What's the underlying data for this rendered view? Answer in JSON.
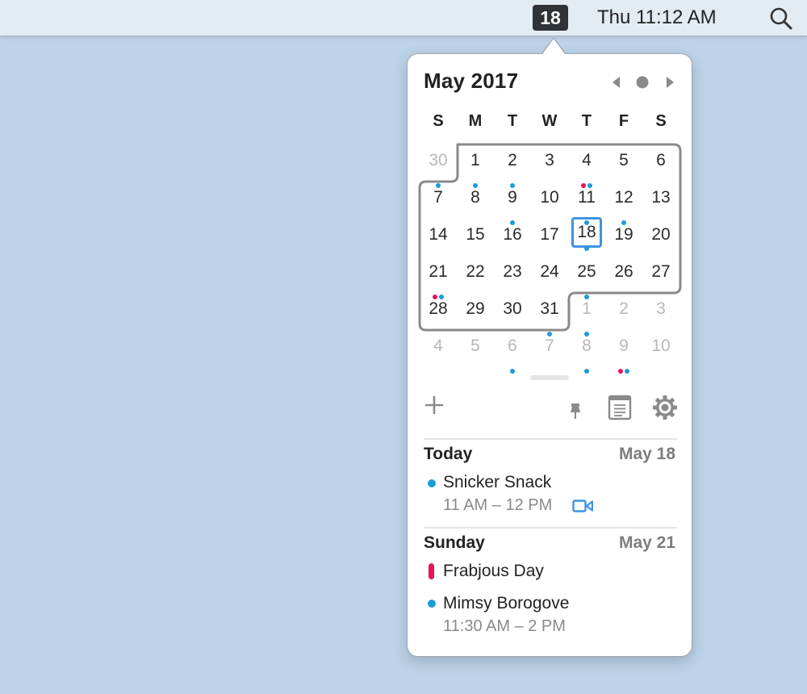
{
  "menubar": {
    "date_badge": "18",
    "clock": "Thu 11:12 AM",
    "search_icon": "magnifying-glass-icon"
  },
  "calendar": {
    "title": "May 2017",
    "nav": {
      "prev_icon": "triangle-left-icon",
      "today_icon": "circle-dot-icon",
      "next_icon": "triangle-right-icon"
    },
    "weekdays": [
      "S",
      "M",
      "T",
      "W",
      "T",
      "F",
      "S"
    ],
    "weeks": [
      [
        {
          "d": "30",
          "dim": true,
          "dots": [
            "#1e9bd7"
          ]
        },
        {
          "d": "1",
          "dots": [
            "#1e9bd7"
          ]
        },
        {
          "d": "2",
          "dots": [
            "#1e9bd7"
          ]
        },
        {
          "d": "3",
          "dots": []
        },
        {
          "d": "4",
          "dots": [
            "#e8135a",
            "#1e9bd7"
          ]
        },
        {
          "d": "5",
          "dots": []
        },
        {
          "d": "6",
          "dots": []
        }
      ],
      [
        {
          "d": "7",
          "dots": []
        },
        {
          "d": "8",
          "dots": []
        },
        {
          "d": "9",
          "dots": [
            "#1e9bd7"
          ]
        },
        {
          "d": "10",
          "dots": []
        },
        {
          "d": "11",
          "dots": [
            "#1e9bd7"
          ]
        },
        {
          "d": "12",
          "dots": [
            "#1e9bd7"
          ]
        },
        {
          "d": "13",
          "dots": []
        }
      ],
      [
        {
          "d": "14",
          "dots": []
        },
        {
          "d": "15",
          "dots": []
        },
        {
          "d": "16",
          "dots": []
        },
        {
          "d": "17",
          "dots": []
        },
        {
          "d": "18",
          "today": true,
          "dots": [
            "#1e9bd7"
          ]
        },
        {
          "d": "19",
          "dots": []
        },
        {
          "d": "20",
          "dots": []
        }
      ],
      [
        {
          "d": "21",
          "dots": [
            "#e8135a",
            "#1e9bd7"
          ]
        },
        {
          "d": "22",
          "dots": []
        },
        {
          "d": "23",
          "dots": []
        },
        {
          "d": "24",
          "dots": []
        },
        {
          "d": "25",
          "dots": [
            "#1e9bd7"
          ]
        },
        {
          "d": "26",
          "dots": []
        },
        {
          "d": "27",
          "dots": []
        }
      ],
      [
        {
          "d": "28",
          "dots": []
        },
        {
          "d": "29",
          "dots": []
        },
        {
          "d": "30",
          "dots": []
        },
        {
          "d": "31",
          "dots": [
            "#1e9bd7"
          ]
        },
        {
          "d": "1",
          "dim": true,
          "dots": [
            "#1e9bd7"
          ]
        },
        {
          "d": "2",
          "dim": true,
          "dots": []
        },
        {
          "d": "3",
          "dim": true,
          "dots": []
        }
      ],
      [
        {
          "d": "4",
          "dim": true,
          "dots": []
        },
        {
          "d": "5",
          "dim": true,
          "dots": []
        },
        {
          "d": "6",
          "dim": true,
          "dots": [
            "#1e9bd7"
          ]
        },
        {
          "d": "7",
          "dim": true,
          "dots": []
        },
        {
          "d": "8",
          "dim": true,
          "dots": [
            "#1e9bd7"
          ]
        },
        {
          "d": "9",
          "dim": true,
          "dots": [
            "#e8135a",
            "#1e9bd7"
          ]
        },
        {
          "d": "10",
          "dim": true,
          "dots": []
        }
      ]
    ]
  },
  "toolbar": {
    "add_icon": "plus-icon",
    "pin_icon": "pin-icon",
    "list_icon": "document-list-icon",
    "settings_icon": "gear-icon"
  },
  "agenda": [
    {
      "heading": "Today",
      "date": "May 18",
      "events": [
        {
          "title": "Snicker Snack",
          "time": "11 AM – 12 PM",
          "color": "#1e9bd7",
          "marker": "dot",
          "video": true,
          "video_icon": "video-camera-icon"
        }
      ]
    },
    {
      "heading": "Sunday",
      "date": "May 21",
      "events": [
        {
          "title": "Frabjous Day",
          "time": "",
          "color": "#e8135a",
          "marker": "bar",
          "video": false
        },
        {
          "title": "Mimsy Borogove",
          "time": "11:30 AM – 2 PM",
          "color": "#1e9bd7",
          "marker": "dot",
          "video": false
        }
      ]
    }
  ],
  "colors": {
    "accent": "#3f93e2",
    "event_blue": "#1e9bd7",
    "event_red": "#e8135a"
  }
}
